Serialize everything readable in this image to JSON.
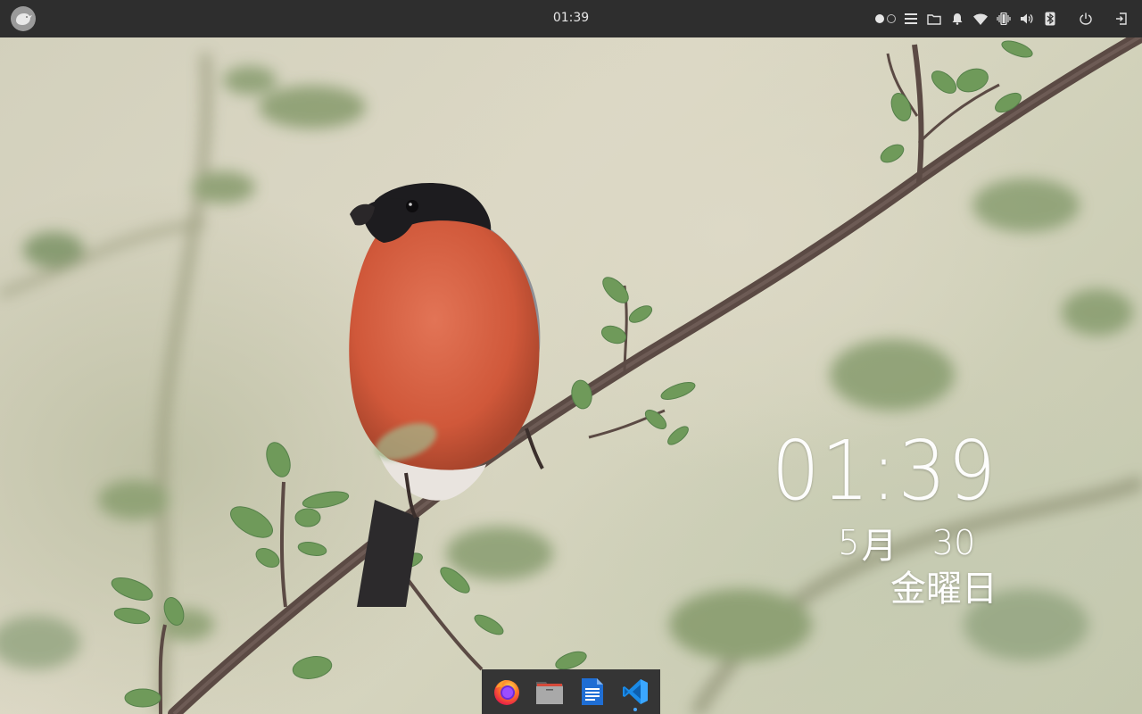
{
  "panel": {
    "clock": "01:39",
    "launcher_icon": "bird-logo-icon",
    "workspaces": [
      {
        "name": "workspace-1",
        "active": true
      },
      {
        "name": "workspace-2",
        "active": false
      }
    ],
    "tray_icons": [
      "menu-icon",
      "folder-icon",
      "bell-icon",
      "wifi-icon",
      "vibrate-icon",
      "volume-icon",
      "bluetooth-icon",
      "power-icon",
      "logout-icon"
    ]
  },
  "desktop_clock": {
    "time": "01:39",
    "month_num": "5",
    "month_unit": "月",
    "day": "30",
    "weekday": "金曜日"
  },
  "dock": {
    "apps": [
      {
        "name": "Firefox",
        "icon": "firefox-icon",
        "running": false
      },
      {
        "name": "Files",
        "icon": "files-icon",
        "running": false
      },
      {
        "name": "Writer",
        "icon": "document-icon",
        "running": false
      },
      {
        "name": "Visual Studio Code",
        "icon": "vscode-icon",
        "running": true
      }
    ]
  },
  "colors": {
    "panel_bg": "#2e2e2e",
    "dock_bg": "#353535",
    "accent": "#4aa8ff"
  }
}
